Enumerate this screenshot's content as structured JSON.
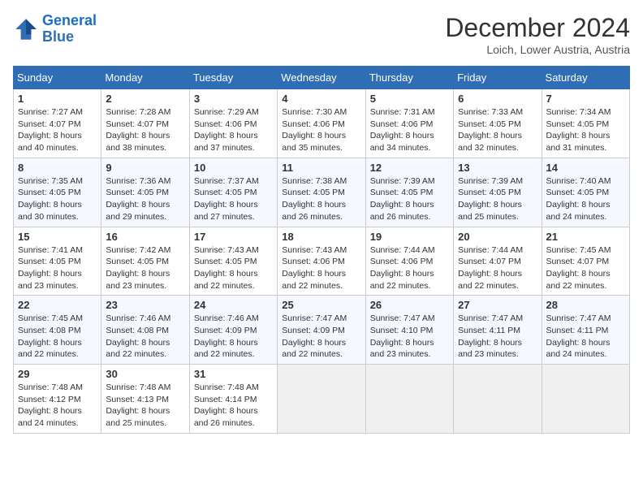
{
  "header": {
    "logo_line1": "General",
    "logo_line2": "Blue",
    "month": "December 2024",
    "location": "Loich, Lower Austria, Austria"
  },
  "days_of_week": [
    "Sunday",
    "Monday",
    "Tuesday",
    "Wednesday",
    "Thursday",
    "Friday",
    "Saturday"
  ],
  "weeks": [
    [
      {
        "day": "1",
        "info": "Sunrise: 7:27 AM\nSunset: 4:07 PM\nDaylight: 8 hours\nand 40 minutes."
      },
      {
        "day": "2",
        "info": "Sunrise: 7:28 AM\nSunset: 4:07 PM\nDaylight: 8 hours\nand 38 minutes."
      },
      {
        "day": "3",
        "info": "Sunrise: 7:29 AM\nSunset: 4:06 PM\nDaylight: 8 hours\nand 37 minutes."
      },
      {
        "day": "4",
        "info": "Sunrise: 7:30 AM\nSunset: 4:06 PM\nDaylight: 8 hours\nand 35 minutes."
      },
      {
        "day": "5",
        "info": "Sunrise: 7:31 AM\nSunset: 4:06 PM\nDaylight: 8 hours\nand 34 minutes."
      },
      {
        "day": "6",
        "info": "Sunrise: 7:33 AM\nSunset: 4:05 PM\nDaylight: 8 hours\nand 32 minutes."
      },
      {
        "day": "7",
        "info": "Sunrise: 7:34 AM\nSunset: 4:05 PM\nDaylight: 8 hours\nand 31 minutes."
      }
    ],
    [
      {
        "day": "8",
        "info": "Sunrise: 7:35 AM\nSunset: 4:05 PM\nDaylight: 8 hours\nand 30 minutes."
      },
      {
        "day": "9",
        "info": "Sunrise: 7:36 AM\nSunset: 4:05 PM\nDaylight: 8 hours\nand 29 minutes."
      },
      {
        "day": "10",
        "info": "Sunrise: 7:37 AM\nSunset: 4:05 PM\nDaylight: 8 hours\nand 27 minutes."
      },
      {
        "day": "11",
        "info": "Sunrise: 7:38 AM\nSunset: 4:05 PM\nDaylight: 8 hours\nand 26 minutes."
      },
      {
        "day": "12",
        "info": "Sunrise: 7:39 AM\nSunset: 4:05 PM\nDaylight: 8 hours\nand 26 minutes."
      },
      {
        "day": "13",
        "info": "Sunrise: 7:39 AM\nSunset: 4:05 PM\nDaylight: 8 hours\nand 25 minutes."
      },
      {
        "day": "14",
        "info": "Sunrise: 7:40 AM\nSunset: 4:05 PM\nDaylight: 8 hours\nand 24 minutes."
      }
    ],
    [
      {
        "day": "15",
        "info": "Sunrise: 7:41 AM\nSunset: 4:05 PM\nDaylight: 8 hours\nand 23 minutes."
      },
      {
        "day": "16",
        "info": "Sunrise: 7:42 AM\nSunset: 4:05 PM\nDaylight: 8 hours\nand 23 minutes."
      },
      {
        "day": "17",
        "info": "Sunrise: 7:43 AM\nSunset: 4:05 PM\nDaylight: 8 hours\nand 22 minutes."
      },
      {
        "day": "18",
        "info": "Sunrise: 7:43 AM\nSunset: 4:06 PM\nDaylight: 8 hours\nand 22 minutes."
      },
      {
        "day": "19",
        "info": "Sunrise: 7:44 AM\nSunset: 4:06 PM\nDaylight: 8 hours\nand 22 minutes."
      },
      {
        "day": "20",
        "info": "Sunrise: 7:44 AM\nSunset: 4:07 PM\nDaylight: 8 hours\nand 22 minutes."
      },
      {
        "day": "21",
        "info": "Sunrise: 7:45 AM\nSunset: 4:07 PM\nDaylight: 8 hours\nand 22 minutes."
      }
    ],
    [
      {
        "day": "22",
        "info": "Sunrise: 7:45 AM\nSunset: 4:08 PM\nDaylight: 8 hours\nand 22 minutes."
      },
      {
        "day": "23",
        "info": "Sunrise: 7:46 AM\nSunset: 4:08 PM\nDaylight: 8 hours\nand 22 minutes."
      },
      {
        "day": "24",
        "info": "Sunrise: 7:46 AM\nSunset: 4:09 PM\nDaylight: 8 hours\nand 22 minutes."
      },
      {
        "day": "25",
        "info": "Sunrise: 7:47 AM\nSunset: 4:09 PM\nDaylight: 8 hours\nand 22 minutes."
      },
      {
        "day": "26",
        "info": "Sunrise: 7:47 AM\nSunset: 4:10 PM\nDaylight: 8 hours\nand 23 minutes."
      },
      {
        "day": "27",
        "info": "Sunrise: 7:47 AM\nSunset: 4:11 PM\nDaylight: 8 hours\nand 23 minutes."
      },
      {
        "day": "28",
        "info": "Sunrise: 7:47 AM\nSunset: 4:11 PM\nDaylight: 8 hours\nand 24 minutes."
      }
    ],
    [
      {
        "day": "29",
        "info": "Sunrise: 7:48 AM\nSunset: 4:12 PM\nDaylight: 8 hours\nand 24 minutes."
      },
      {
        "day": "30",
        "info": "Sunrise: 7:48 AM\nSunset: 4:13 PM\nDaylight: 8 hours\nand 25 minutes."
      },
      {
        "day": "31",
        "info": "Sunrise: 7:48 AM\nSunset: 4:14 PM\nDaylight: 8 hours\nand 26 minutes."
      },
      {
        "day": "",
        "info": ""
      },
      {
        "day": "",
        "info": ""
      },
      {
        "day": "",
        "info": ""
      },
      {
        "day": "",
        "info": ""
      }
    ]
  ]
}
